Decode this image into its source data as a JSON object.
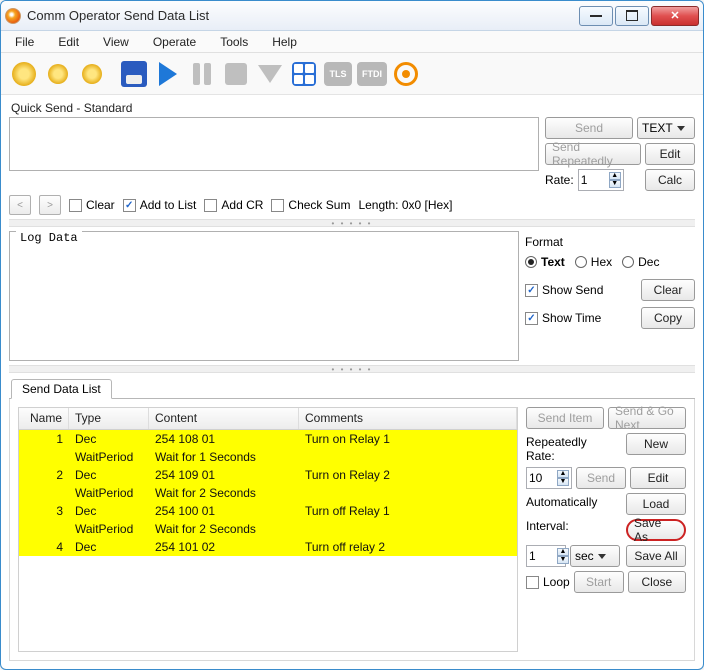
{
  "title": "Comm Operator    Send Data List",
  "menu": {
    "file": "File",
    "edit": "Edit",
    "view": "View",
    "operate": "Operate",
    "tools": "Tools",
    "help": "Help"
  },
  "toolbar": {
    "tls": "TLS",
    "ftdi": "FTDI"
  },
  "quicksend": {
    "label": "Quick Send - Standard",
    "send": "Send",
    "text_combo": "TEXT",
    "send_rep": "Send Repeatedly",
    "edit": "Edit",
    "rate_lbl": "Rate:",
    "rate_val": "1",
    "calc": "Calc",
    "clear": "Clear",
    "add_list": "Add to List",
    "add_cr": "Add CR",
    "checksum": "Check Sum",
    "length": "Length: 0x0 [Hex]"
  },
  "log": {
    "label": "Log Data",
    "format": "Format",
    "opt_text": "Text",
    "opt_hex": "Hex",
    "opt_dec": "Dec",
    "show_send": "Show Send",
    "show_time": "Show Time",
    "clear": "Clear",
    "copy": "Copy"
  },
  "list": {
    "tab": "Send Data List",
    "cols": {
      "name": "Name",
      "type": "Type",
      "content": "Content",
      "comments": "Comments"
    },
    "rows": [
      {
        "name": "1",
        "type": "Dec",
        "content": "254 108 01",
        "comments": "Turn on Relay 1",
        "hl": true
      },
      {
        "name": "",
        "type": "WaitPeriod",
        "content": "Wait for 1 Seconds",
        "comments": "",
        "hl": true
      },
      {
        "name": "2",
        "type": "Dec",
        "content": "254 109 01",
        "comments": "Turn on Relay 2",
        "hl": true
      },
      {
        "name": "",
        "type": "WaitPeriod",
        "content": "Wait for 2 Seconds",
        "comments": "",
        "hl": true
      },
      {
        "name": "3",
        "type": "Dec",
        "content": "254 100 01",
        "comments": "Turn off Relay 1",
        "hl": true
      },
      {
        "name": "",
        "type": "WaitPeriod",
        "content": "Wait for 2 Seconds",
        "comments": "",
        "hl": true
      },
      {
        "name": "4",
        "type": "Dec",
        "content": "254 101 02",
        "comments": "Turn off relay 2",
        "hl": true
      },
      {
        "name": "",
        "type": "",
        "content": "",
        "comments": "",
        "hl": false
      },
      {
        "name": "",
        "type": "",
        "content": "",
        "comments": "",
        "hl": false
      },
      {
        "name": "",
        "type": "",
        "content": "",
        "comments": "",
        "hl": false
      },
      {
        "name": "",
        "type": "",
        "content": "",
        "comments": "",
        "hl": false
      },
      {
        "name": "",
        "type": "",
        "content": "",
        "comments": "",
        "hl": false
      }
    ],
    "side": {
      "send_item": "Send Item",
      "send_go": "Send & Go Next",
      "repeatedly": "Repeatedly",
      "rate_lbl": "Rate:",
      "rate_val": "10",
      "send": "Send",
      "new": "New",
      "edit": "Edit",
      "load": "Load",
      "automatically": "Automatically",
      "interval_lbl": "Interval:",
      "interval_val": "1",
      "interval_unit": "sec",
      "saveas": "Save As",
      "saveall": "Save All",
      "loop": "Loop",
      "start": "Start",
      "close": "Close"
    }
  }
}
